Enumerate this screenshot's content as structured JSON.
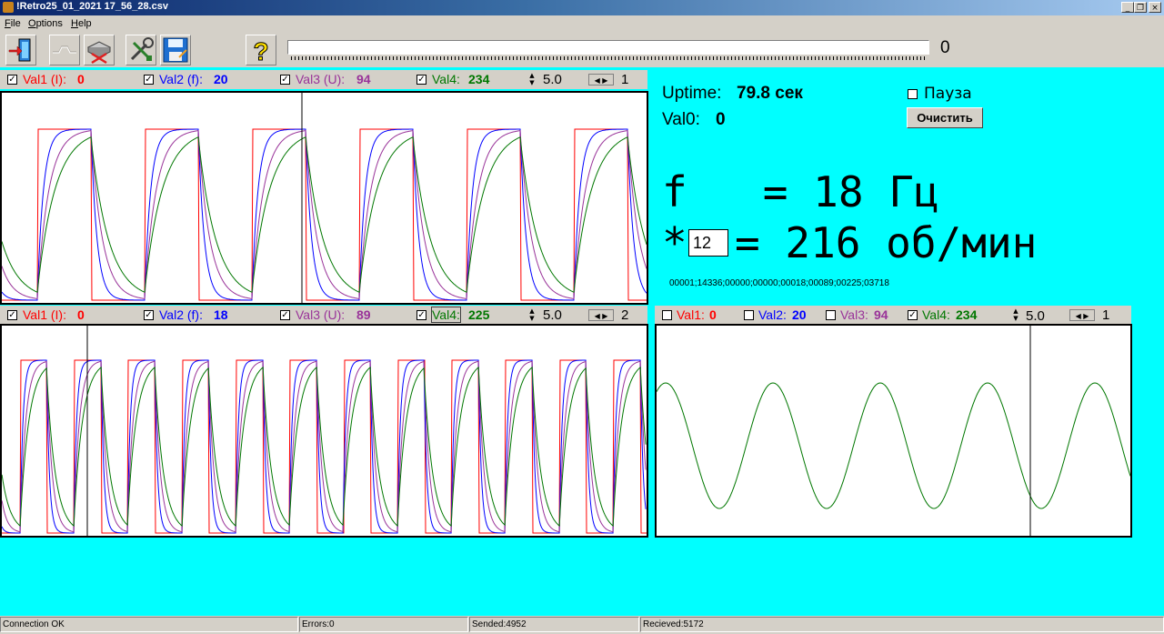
{
  "window": {
    "title": "!Retro25_01_2021 17_56_28.csv",
    "minimize": "_",
    "restore": "❐",
    "close": "×"
  },
  "menu": [
    {
      "label": "File",
      "underline": "F",
      "rest": "ile"
    },
    {
      "label": "Options",
      "underline": "O",
      "rest": "ptions"
    },
    {
      "label": "Help",
      "underline": "H",
      "rest": "elp"
    }
  ],
  "toolbar": {
    "progress_value": "0",
    "help_glyph": "?"
  },
  "colors": {
    "val1": "#ff0000",
    "val2": "#0000ff",
    "val3": "#993399",
    "val4": "#007700"
  },
  "panel1": {
    "val1_label": "Val1 (I):",
    "val1_value": "0",
    "val2_label": "Val2 (f):",
    "val2_value": "20",
    "val3_label": "Val3 (U):",
    "val3_value": "94",
    "val4_label": "Val4:",
    "val4_value": "234",
    "scale": "5.0",
    "number": "1",
    "checked": [
      true,
      true,
      true,
      true
    ]
  },
  "panel2": {
    "val1_label": "Val1 (I):",
    "val1_value": "0",
    "val2_label": "Val2 (f):",
    "val2_value": "18",
    "val3_label": "Val3 (U):",
    "val3_value": "89",
    "val4_label": "Val4:",
    "val4_value": "225",
    "scale": "5.0",
    "number": "2",
    "checked": [
      true,
      true,
      true,
      true
    ]
  },
  "panel3": {
    "val1_label": "Val1:",
    "val1_value": "0",
    "val2_label": "Val2:",
    "val2_value": "20",
    "val3_label": "Val3:",
    "val3_value": "94",
    "val4_label": "Val4:",
    "val4_value": "234",
    "scale": "5.0",
    "number": "1",
    "checked": [
      false,
      false,
      false,
      true
    ]
  },
  "info": {
    "uptime_label": "Uptime:",
    "uptime_value": "79.8 сек",
    "val0_label": "Val0:",
    "val0_value": "0",
    "pause_label": "Пауза",
    "clear_button": "Очистить",
    "freq_line": "f   = 18 Гц",
    "mult_prefix": "*",
    "mult_value": "12",
    "rpm_rest": "= 216 об/мин",
    "raw_data": "00001;14336;00000;00000;00018;00089;00225;03718"
  },
  "status": {
    "connection": "Connection OK",
    "errors": "Errors:0",
    "sended": "Sended:4952",
    "recieved": "Recieved:5172"
  }
}
